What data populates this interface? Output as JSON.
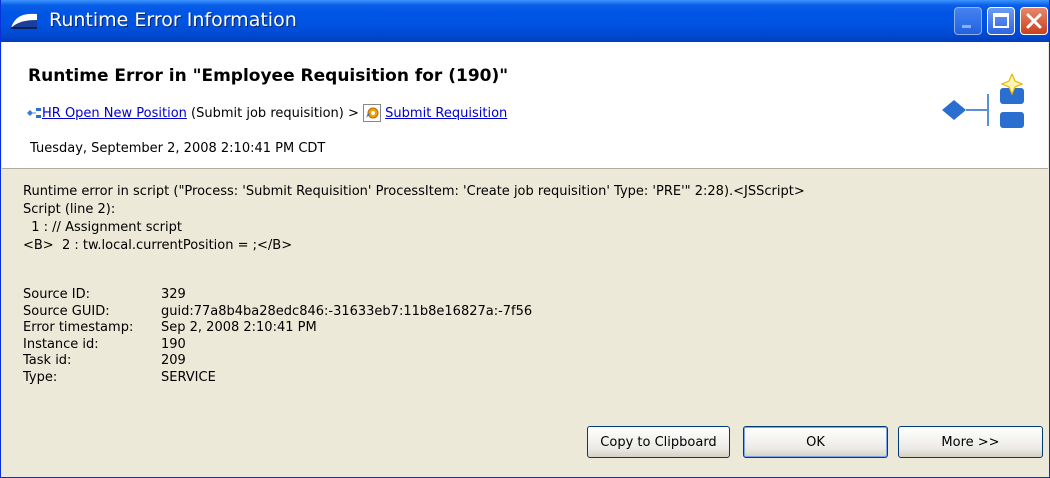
{
  "window": {
    "title": "Runtime Error Information",
    "accent_color": "#0055e5"
  },
  "header": {
    "heading": "Runtime Error in \"Employee Requisition for (190)\"",
    "breadcrumb": {
      "process_icon": "process-flow-icon",
      "process_link": "HR Open New Position",
      "process_context": "(Submit job requisition)",
      "separator": ">",
      "step_icon": "service-gear-icon",
      "step_link": "Submit Requisition"
    },
    "timestamp": "Tuesday, September 2, 2008 2:10:41 PM CDT",
    "banner_icon": "process-diagram-banner-icon"
  },
  "error": {
    "lines": [
      "Runtime error in script (\"Process: 'Submit Requisition' ProcessItem: 'Create job requisition' Type: 'PRE'\" 2:28).<JSScript>",
      "Script (line 2):",
      "  1 : // Assignment script",
      "<B>  2 : tw.local.currentPosition = ;</B>"
    ],
    "details": [
      {
        "label": "Source ID:",
        "value": "329"
      },
      {
        "label": "Source GUID:",
        "value": "guid:77a8b4ba28edc846:-31633eb7:11b8e16827a:-7f56"
      },
      {
        "label": "Error timestamp:",
        "value": "Sep 2, 2008 2:10:41 PM"
      },
      {
        "label": "Instance id:",
        "value": "190"
      },
      {
        "label": "Task id:",
        "value": "209"
      },
      {
        "label": "Type:",
        "value": "SERVICE"
      }
    ]
  },
  "buttons": {
    "copy": "Copy to Clipboard",
    "ok": "OK",
    "more": "More >>"
  }
}
